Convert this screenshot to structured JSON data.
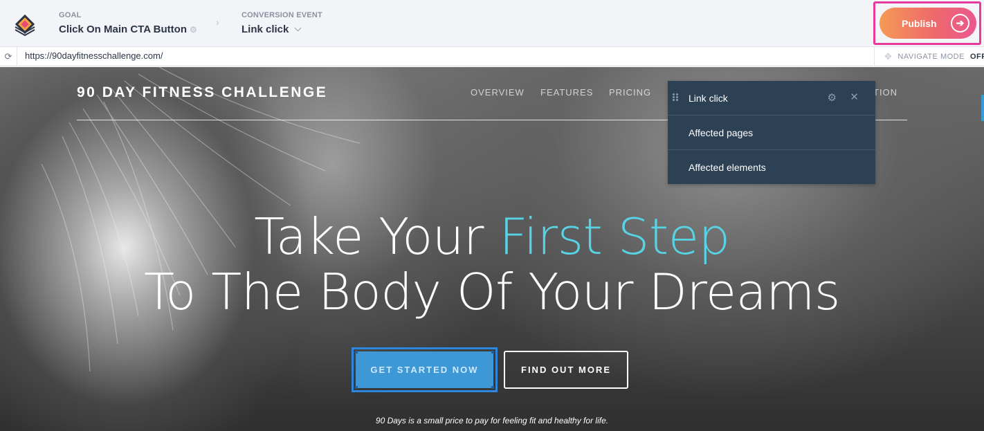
{
  "goal_bar": {
    "goal_label": "GOAL",
    "goal_value": "Click On Main CTA Button",
    "conversion_label": "CONVERSION EVENT",
    "conversion_value": "Link click",
    "publish_label": "Publish"
  },
  "url_bar": {
    "url": "https://90dayfitnesschallenge.com/",
    "navigate_mode_label": "NAVIGATE MODE",
    "navigate_mode_state": "OFF"
  },
  "site": {
    "brand": "90 DAY FITNESS CHALLENGE",
    "nav_items": [
      "OVERVIEW",
      "FEATURES",
      "PRICING",
      "TION"
    ],
    "headline_part1": "Take Your ",
    "headline_accent": "First Step",
    "headline_line2": "To The Body Of Your Dreams",
    "cta_primary": "GET STARTED NOW",
    "cta_secondary": "FIND OUT MORE",
    "tagline": "90 Days is a small price to pay for feeling fit and healthy for life."
  },
  "panel": {
    "title": "Link click",
    "items": [
      "Affected pages",
      "Affected elements"
    ]
  },
  "icons": {
    "logo": "stacked-layers-logo",
    "refresh": "refresh-icon",
    "publish": "arrow-right-circle-icon",
    "navigate": "crosshair-icon",
    "settings": "gear-icon",
    "close": "close-icon",
    "drag": "drag-handle-icon"
  },
  "colors": {
    "accent_cyan": "#58d3e4",
    "publish_gradient_start": "#f59a55",
    "publish_gradient_end": "#e9578f",
    "highlight_border": "#e7389c",
    "cta_blue": "#3e98d6",
    "panel_bg": "#2d4155"
  }
}
